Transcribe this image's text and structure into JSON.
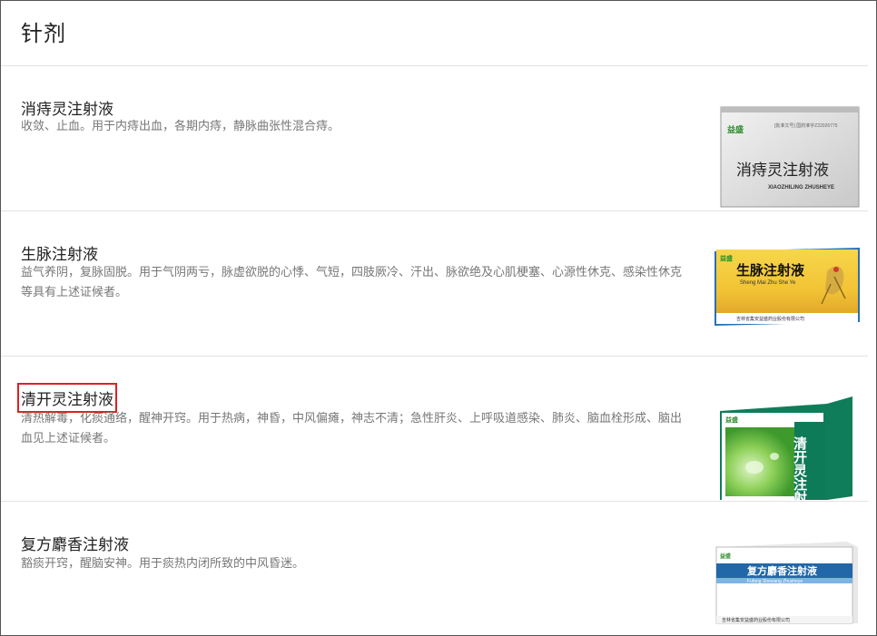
{
  "page": {
    "title": "针剂"
  },
  "products": [
    {
      "name": "消痔灵注射液",
      "description": "收敛、止血。用于内痔出血，各期内痔，静脉曲张性混合痔。",
      "image": {
        "brand": "益盛",
        "title": "消痔灵注射液",
        "pinyin": "XIAOZHILING ZHUSHEYE",
        "approval": "[批准文号] 国药准字Z22026775"
      }
    },
    {
      "name": "生脉注射液",
      "description": "益气养阴，复脉固脱。用于气阴两亏，脉虚欲脱的心悸、气短，四肢厥冷、汗出、脉欲绝及心肌梗塞、心源性休克、感染性休克等具有上述证候者。",
      "image": {
        "brand": "益盛",
        "title": "生脉注射液",
        "pinyin": "Sheng  Mai  Zhu  She  Ye",
        "maker": "吉林省集安益盛药业股份有限公司"
      }
    },
    {
      "name": "清开灵注射液",
      "description": "清热解毒，化痰通络，醒神开窍。用于热病，神昏，中风偏瘫，神志不清；急性肝炎、上呼吸道感染、肺炎、脑血栓形成、脑出血见上述证候者。",
      "image": {
        "brand": "益盛",
        "title": "清开灵注射"
      }
    },
    {
      "name": "复方麝香注射液",
      "description": "豁痰开窍，醒脑安神。用于痰热内闭所致的中风昏迷。",
      "image": {
        "brand": "益盛",
        "title": "复方麝香注射液",
        "pinyin": "Fufang Shexiang Zhusheye",
        "maker": "吉林省集安益盛药业股份有限公司"
      }
    }
  ],
  "colors": {
    "highlight": "#e02020",
    "divider": "#e3e3e3",
    "title": "#222222",
    "description": "#777777"
  }
}
